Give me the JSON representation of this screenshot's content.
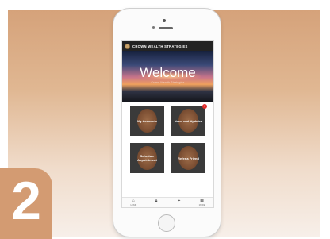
{
  "step": {
    "number": "2"
  },
  "app": {
    "title": "CROWN WEALTH STRATEGIES"
  },
  "hero": {
    "title": "Welcome",
    "subtitle": "Crown Wealth Strategies"
  },
  "tiles": [
    {
      "label": "My Accounts",
      "badge": ""
    },
    {
      "label": "News and Updates",
      "badge": "!"
    },
    {
      "label": "Schedule Appointment",
      "badge": ""
    },
    {
      "label": "Refer a Friend",
      "badge": ""
    }
  ],
  "tabbar": {
    "items": [
      {
        "label": "HOME",
        "icon": "home-icon"
      },
      {
        "label": "",
        "icon": "lock-icon"
      },
      {
        "label": "",
        "icon": "location-pin-icon"
      },
      {
        "label": "MORE",
        "icon": "grid-icon"
      }
    ]
  },
  "colors": {
    "background_top": "#d5a27a",
    "badge": "#d39b72",
    "tile": "#3a3a3a",
    "header": "#232323",
    "notification": "#e02a2a"
  }
}
